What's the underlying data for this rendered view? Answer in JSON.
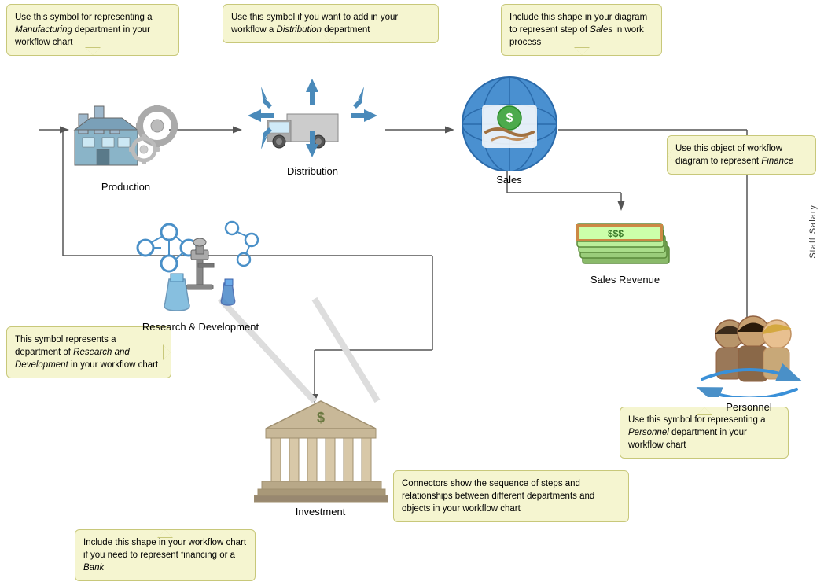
{
  "tooltips": {
    "manufacturing": "Use this symbol for representing a <em>Manufacturing</em> department in your workflow chart",
    "distribution": "Use this symbol if you want to add in your workflow a <em>Distribution</em> department",
    "sales": "Include this shape in your diagram to represent step of <em>Sales</em> in work process",
    "finance": "Use this object of workflow diagram to represent <em>Finance</em>",
    "rd": "This symbol represents a department of <em>Research and Development</em> in your workflow chart",
    "bank": "Include this shape in your workflow chart if you need to represent financing or a <em>Bank</em>",
    "personnel": "Use this symbol for representing a <em>Personnel</em> department in your workflow chart",
    "connectors": "Connectors show the sequence of steps and relationships between different departments and objects in your workflow chart"
  },
  "nodes": {
    "production": "Production",
    "distribution": "Distribution",
    "sales": "Sales",
    "salesRevenue": "Sales Revenue",
    "rd": "Research & Development",
    "investment": "Investment",
    "personnel": "Personnel",
    "staffSalary": "Staff Salary"
  }
}
